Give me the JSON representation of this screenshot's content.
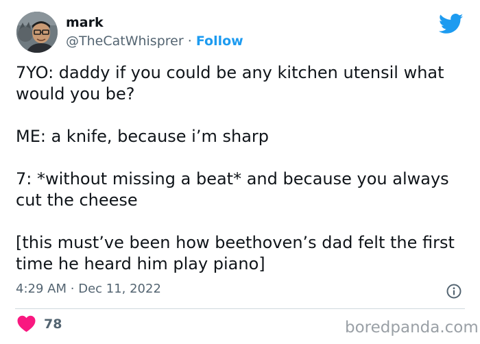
{
  "author": {
    "name": "mark",
    "handle": "@TheCatWhisprer",
    "separator": "·",
    "follow_label": "Follow"
  },
  "tweet": {
    "paragraphs": [
      "7YO: daddy if you could be any kitchen utensil what would you be?",
      "ME: a knife, because i’m sharp",
      "7: *without missing a beat* and because you always cut the cheese",
      "[this must’ve been how beethoven’s dad felt the first time he heard him play piano]"
    ],
    "time": "4:29 AM",
    "separator": "·",
    "date": "Dec 11, 2022",
    "likes": "78"
  },
  "watermark": "boredpanda.com",
  "icons": {
    "brand": "twitter-bird-icon",
    "info": "info-icon",
    "like": "heart-icon"
  },
  "colors": {
    "twitter_blue": "#1d9bf0",
    "text_primary": "#0f1419",
    "text_secondary": "#536471",
    "heart": "#f91880",
    "divider": "#cfd9de",
    "watermark": "#9aa0a6"
  }
}
